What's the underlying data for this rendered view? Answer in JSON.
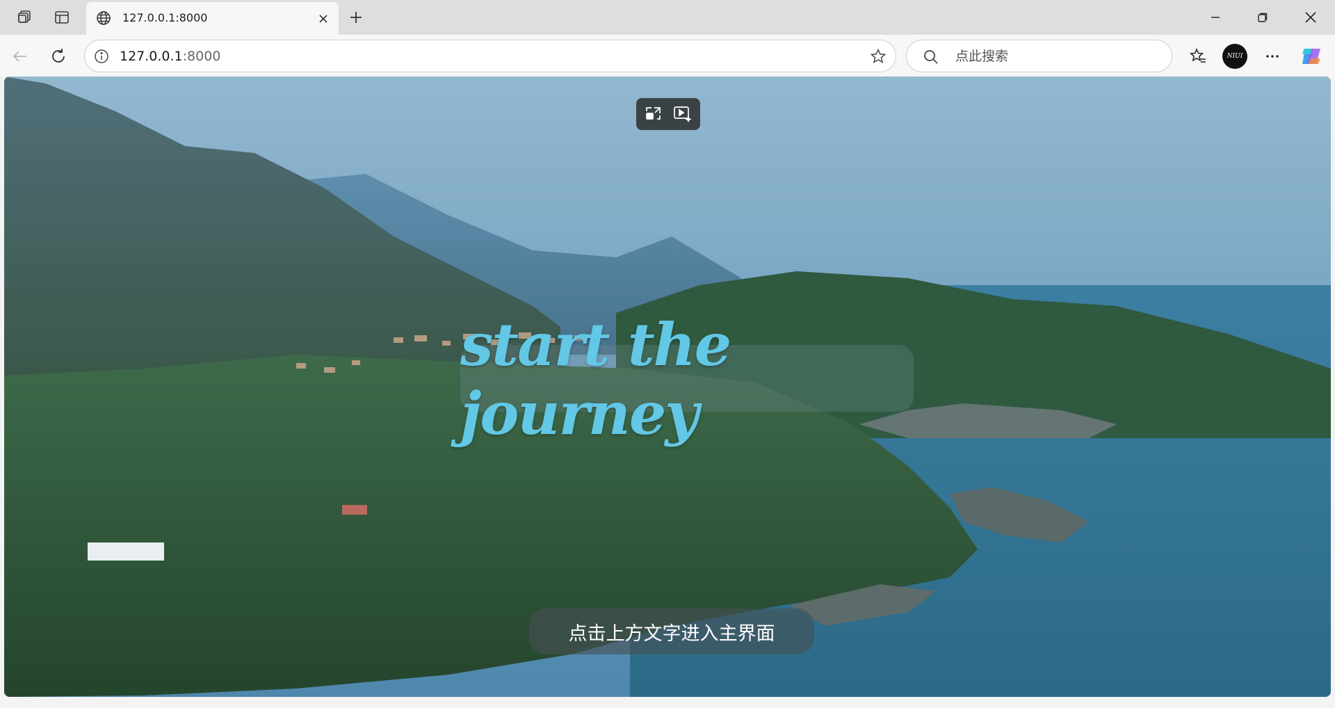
{
  "browser": {
    "tab": {
      "title": "127.0.0.1:8000"
    },
    "address": {
      "host": "127.0.0.1",
      "port": ":8000"
    },
    "search": {
      "placeholder": "点此搜索"
    },
    "profile": {
      "initials": "NIUI"
    }
  },
  "page": {
    "hero_text": "start the journey",
    "hint_text": "点击上方文字进入主界面"
  },
  "colors": {
    "hero_text": "#63c7e6",
    "sea": "#2e6f8c",
    "sky": "#8fb6cf"
  },
  "icons": [
    "workspaces-icon",
    "tab-actions-icon",
    "globe-icon",
    "close-icon",
    "plus-icon",
    "minimize-icon",
    "restore-icon",
    "window-close-icon",
    "back-icon",
    "refresh-icon",
    "info-icon",
    "star-icon",
    "search-icon",
    "favorites-icon",
    "more-icon",
    "copilot-icon",
    "pip-exit-icon",
    "video-ai-icon"
  ]
}
